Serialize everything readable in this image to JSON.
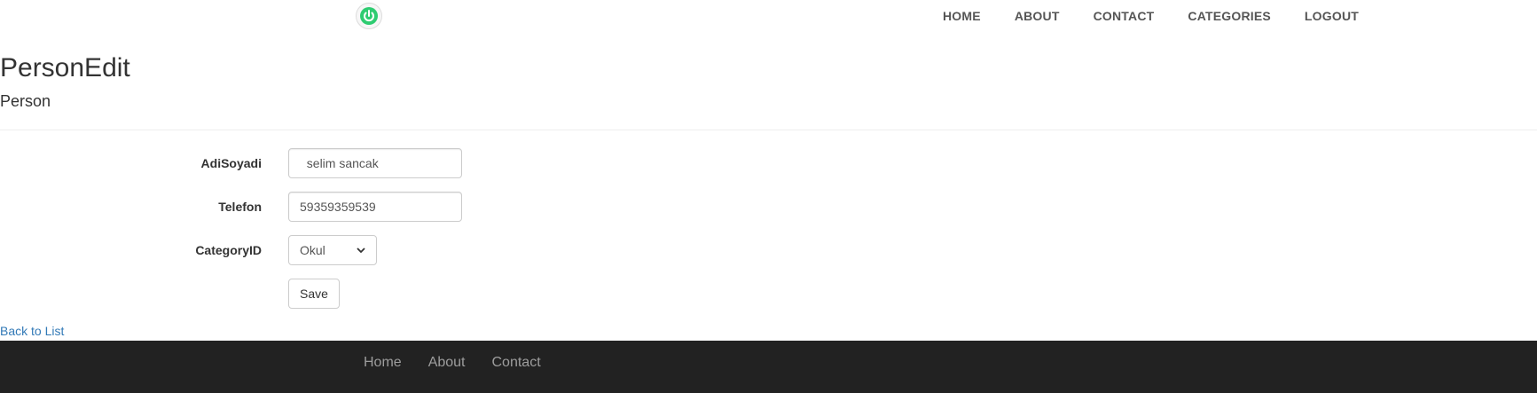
{
  "navbar": {
    "logo_icon": "power-icon",
    "accent_color": "#2ecc71",
    "links": [
      {
        "label": "HOME"
      },
      {
        "label": "ABOUT"
      },
      {
        "label": "CONTACT"
      },
      {
        "label": "CATEGORIES"
      },
      {
        "label": "LOGOUT"
      }
    ]
  },
  "header": {
    "title": "PersonEdit",
    "subtitle": "Person"
  },
  "form": {
    "adisoyadi": {
      "label": "AdiSoyadi",
      "value": "  selim sancak"
    },
    "telefon": {
      "label": "Telefon",
      "value": "59359359539"
    },
    "category": {
      "label": "CategoryID",
      "selected": "Okul"
    },
    "save_label": "Save"
  },
  "back_link": "Back to List",
  "footer": {
    "links": [
      {
        "label": "Home"
      },
      {
        "label": "About"
      },
      {
        "label": "Contact"
      }
    ]
  }
}
